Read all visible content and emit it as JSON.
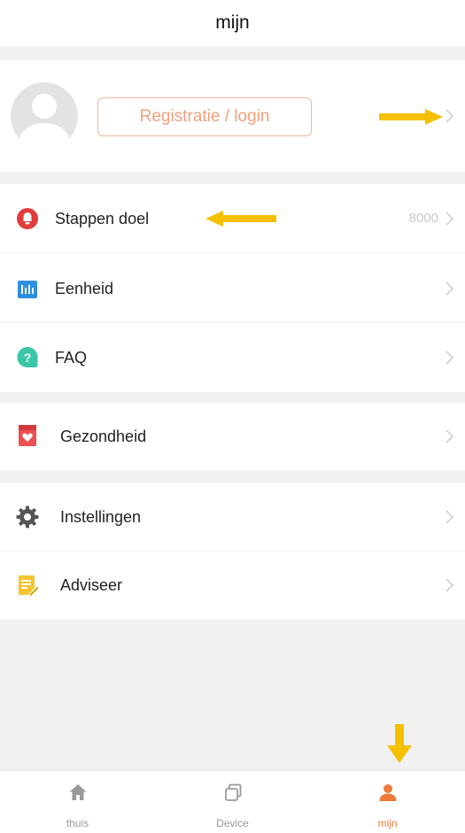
{
  "header": {
    "title": "mijn"
  },
  "profile": {
    "login_label": "Registratie / login"
  },
  "menu": {
    "steps": {
      "label": "Stappen doel",
      "value": "8000"
    },
    "unit": {
      "label": "Eenheid"
    },
    "faq": {
      "label": "FAQ"
    },
    "health": {
      "label": "Gezondheid"
    },
    "settings": {
      "label": "Instellingen"
    },
    "advise": {
      "label": "Adviseer"
    }
  },
  "tabs": [
    {
      "label": "thuis",
      "icon": "home-icon",
      "active": false
    },
    {
      "label": "Device",
      "icon": "device-icon",
      "active": false
    },
    {
      "label": "mijn",
      "icon": "person-icon",
      "active": true
    }
  ],
  "colors": {
    "accent": "#f07a3a",
    "annotation_arrow": "#f5c000",
    "background": "#f1f1f1"
  }
}
